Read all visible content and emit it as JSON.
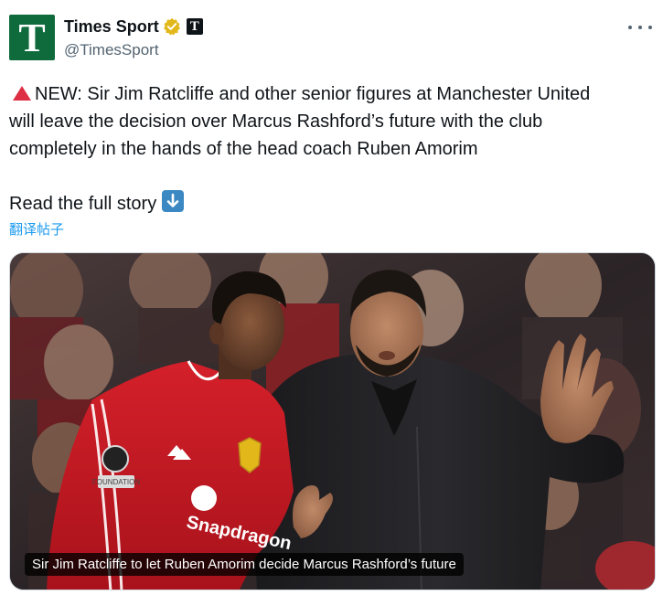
{
  "account": {
    "display_name": "Times Sport",
    "handle": "@TimesSport",
    "avatar_letter": "T",
    "affiliation_letter": "T",
    "avatar_color": "#0f6b3c",
    "verified_badge_color": "#e2b719"
  },
  "tweet": {
    "lines": [
      "NEW: Sir Jim Ratcliffe and other senior figures at Manchester United",
      "will leave the decision over Marcus Rashford’s future with the club",
      "completely in the hands of the head coach Ruben Amorim"
    ],
    "read_more": "Read the full story",
    "emoji_icons": [
      "red-triangle-icon",
      "down-arrow-button-icon"
    ],
    "translate_label": "翻译帖子"
  },
  "media": {
    "caption": "Sir Jim Ratcliffe to let Ruben Amorim decide Marcus Rashford’s future",
    "shirt_sponsor": "Snapdragon",
    "shirt_patch": "FOUNDATION"
  },
  "colors": {
    "link": "#1d9bf0",
    "text": "#0f1419",
    "muted": "#536471"
  }
}
